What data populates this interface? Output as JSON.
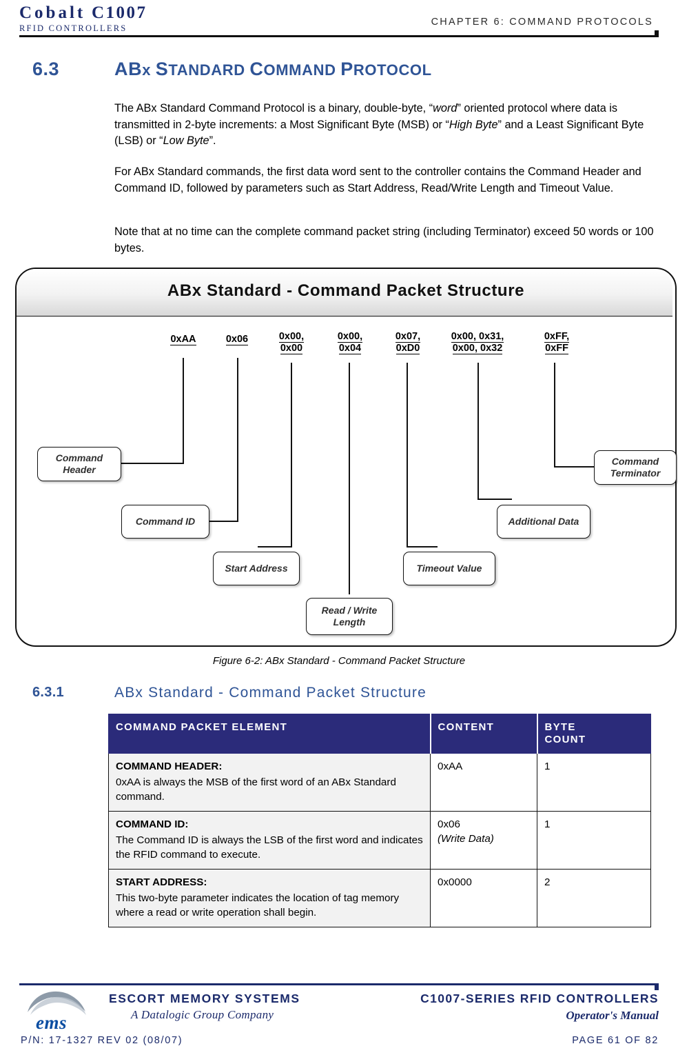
{
  "header": {
    "logo_main_1": "Cobalt",
    "logo_main_2": "C1007",
    "logo_sub": "RFID CONTROLLERS",
    "chapter": "CHAPTER 6: COMMAND PROTOCOLS"
  },
  "section": {
    "number": "6.3",
    "title_parts": {
      "a": "AB",
      "b": "x ",
      "c": "S",
      "d": "TANDARD ",
      "e": "C",
      "f": "OMMAND ",
      "g": "P",
      "h": "ROTOCOL"
    },
    "paragraph_1_a": "The ABx Standard Command Protocol is a binary, double-byte, “",
    "paragraph_1_i1": "word",
    "paragraph_1_b": "” oriented protocol where data is transmitted in 2-byte increments: a Most Significant Byte (MSB) or “",
    "paragraph_1_i2": "High Byte",
    "paragraph_1_c": "” and a Least Significant Byte (LSB) or “",
    "paragraph_1_i3": "Low Byte",
    "paragraph_1_d": "”.",
    "paragraph_2": "For ABx Standard commands, the first data word sent to the controller contains the Command Header and Command ID, followed by parameters such as Start Address, Read/Write Length and Timeout Value.",
    "paragraph_3": "Note that at no time can the complete command packet string (including Terminator) exceed 50 words or 100 bytes."
  },
  "figure": {
    "title": "ABx Standard - Command Packet Structure",
    "caption": "Figure 6-2: ABx Standard - Command Packet Structure",
    "hex_labels": [
      {
        "line1": "0xAA",
        "line2": ""
      },
      {
        "line1": "0x06",
        "line2": ""
      },
      {
        "line1": "0x00,",
        "line2": "0x00"
      },
      {
        "line1": "0x00,",
        "line2": "0x04"
      },
      {
        "line1": "0x07,",
        "line2": "0xD0"
      },
      {
        "line1": "0x00, 0x31,",
        "line2": "0x00, 0x32"
      },
      {
        "line1": "0xFF,",
        "line2": "0xFF"
      }
    ],
    "boxes": [
      {
        "line1": "Command",
        "line2": "Header"
      },
      {
        "line1": "Command ID",
        "line2": ""
      },
      {
        "line1": "Start Address",
        "line2": ""
      },
      {
        "line1": "Read / Write",
        "line2": "Length"
      },
      {
        "line1": "Timeout Value",
        "line2": ""
      },
      {
        "line1": "Additional Data",
        "line2": ""
      },
      {
        "line1": "Command",
        "line2": "Terminator"
      }
    ]
  },
  "subsection": {
    "number": "6.3.1",
    "title": "ABx Standard - Command Packet Structure"
  },
  "table": {
    "headers": {
      "element": "COMMAND PACKET ELEMENT",
      "content": "CONTENT",
      "byte_count_line1": "BYTE",
      "byte_count_line2": "COUNT"
    },
    "rows": [
      {
        "title": "COMMAND HEADER:",
        "desc": "0xAA is always the MSB of the first word of an ABx Standard command.",
        "content": "0xAA",
        "content_note": "",
        "bytes": "1"
      },
      {
        "title": "COMMAND ID:",
        "desc": "The Command ID is always the LSB of the first word and indicates the RFID command to execute.",
        "content": "0x06",
        "content_note": "(Write Data)",
        "bytes": "1"
      },
      {
        "title": "START ADDRESS:",
        "desc": "This two-byte parameter indicates the location of tag memory where a read or write operation shall begin.",
        "content": "0x0000",
        "content_note": "",
        "bytes": "2"
      }
    ]
  },
  "footer": {
    "company": "ESCORT MEMORY SYSTEMS",
    "group": "A Datalogic Group Company",
    "ems_mark": "ems",
    "product": "C1007-SERIES RFID CONTROLLERS",
    "manual": "Operator's Manual",
    "part_number": "P/N: 17-1327 REV 02 (08/07)",
    "page": "PAGE 61 OF 82"
  },
  "colors": {
    "brand_blue": "#1b2a6b",
    "heading_blue": "#2f5496",
    "table_header_bg": "#2b2b7a",
    "table_row_bg": "#f2f2f2"
  }
}
